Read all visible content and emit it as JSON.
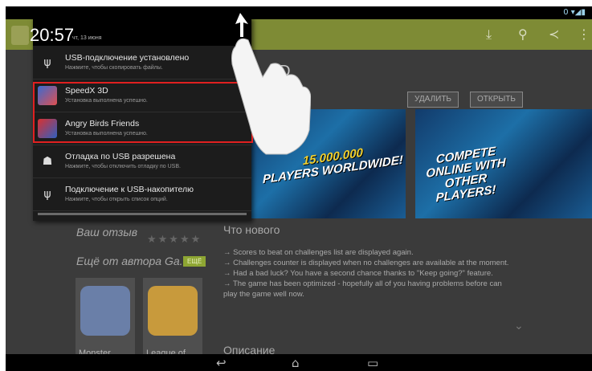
{
  "status_bar": {
    "icons": [
      "signal-icon",
      "wifi-icon",
      "battery-icon"
    ],
    "indicator": "0"
  },
  "app_page": {
    "title_fragment": "3D",
    "uninstall_label": "УДАЛИТЬ",
    "open_label": "ОТКРЫТЬ",
    "screenshot1_caption_a": "15.000.000",
    "screenshot1_caption_b": "PLAYERS WORLDWIDE!",
    "screenshot2_caption": "COMPETE ONLINE WITH OTHER PLAYERS!",
    "review_label": "Ваш отзыв",
    "more_by_label": "Ещё от автора Ga...",
    "more_badge": "ЕЩЁ",
    "whats_new_label": "Что нового",
    "whats_new_lines": [
      "→ Scores to beat on challenges list are displayed again.",
      "→ Challenges counter is displayed when no challenges are available at the moment.",
      "→ Had a bad luck? You have a second chance thanks to \"Keep going?\" feature.",
      "→ The game has been optimized - hopefully all of you having problems before can play the game well now."
    ],
    "description_label": "Описание",
    "related": [
      {
        "label": "Monster"
      },
      {
        "label": "League of"
      }
    ]
  },
  "notification_shade": {
    "time": "20:57",
    "date": "чт, 13 июня",
    "items": [
      {
        "icon": "usb-icon",
        "title": "USB-подключение установлено",
        "subtitle": "Нажмите, чтобы скопировать файлы."
      },
      {
        "icon": "speedx-app-icon",
        "title": "SpeedX 3D",
        "subtitle": "Установка выполнена успешно."
      },
      {
        "icon": "angry-birds-app-icon",
        "title": "Angry Birds Friends",
        "subtitle": "Установка выполнена успешно."
      },
      {
        "icon": "android-debug-icon",
        "title": "Отладка по USB разрешена",
        "subtitle": "Нажмите, чтобы отключить отладку по USB."
      },
      {
        "icon": "usb-storage-icon",
        "title": "Подключение к USB-накопителю",
        "subtitle": "Нажмите, чтобы открыть список опций."
      }
    ]
  },
  "nav_bar": {
    "back": "back-icon",
    "home": "home-icon",
    "recents": "recents-icon"
  },
  "colors": {
    "action_bar": "#7e8b35",
    "highlight_box": "#e02020",
    "shade_bg": "#1c1c1c"
  }
}
